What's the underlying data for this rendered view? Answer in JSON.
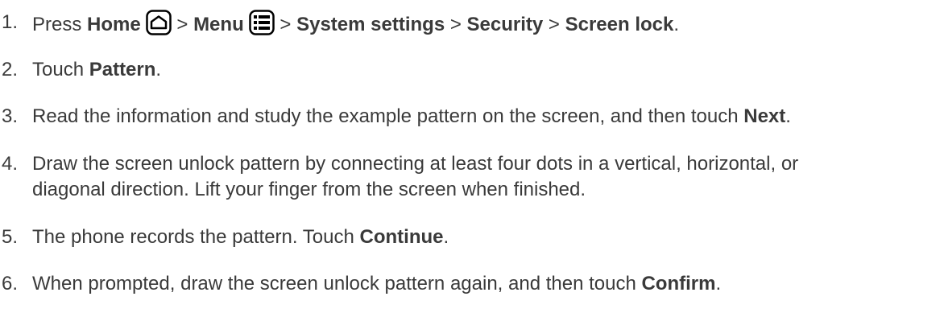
{
  "steps": [
    {
      "number": "1.",
      "parts": {
        "press": "Press ",
        "home": "Home",
        "gt1": " > ",
        "menu": "Menu",
        "gt2": " > ",
        "system_settings": "System settings",
        "gt3": " > ",
        "security": "Security",
        "gt4": " > ",
        "screen_lock": "Screen lock",
        "end": "."
      },
      "icons": [
        "home-icon",
        "menu-icon"
      ]
    },
    {
      "number": "2.",
      "parts": {
        "pre": "Touch ",
        "bold": "Pattern",
        "post": "."
      }
    },
    {
      "number": "3.",
      "parts": {
        "pre": "Read the information and study the example pattern on the screen, and then touch ",
        "bold": "Next",
        "post": "."
      }
    },
    {
      "number": "4.",
      "parts": {
        "line1": "Draw the screen unlock pattern by connecting at least four dots in a vertical, horizontal, or",
        "line2": "diagonal direction. Lift your finger from the screen when finished."
      }
    },
    {
      "number": "5.",
      "parts": {
        "pre": "The phone records the pattern. Touch ",
        "bold": "Continue",
        "post": "."
      }
    },
    {
      "number": "6.",
      "parts": {
        "pre": "When prompted, draw the screen unlock pattern again, and then touch ",
        "bold": "Confirm",
        "post": "."
      }
    }
  ]
}
